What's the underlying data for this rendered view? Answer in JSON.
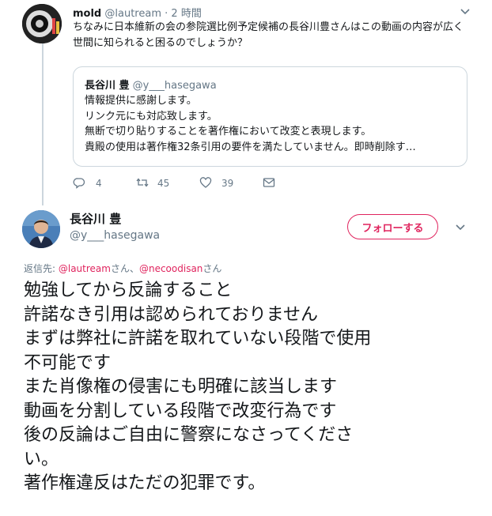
{
  "tweet1": {
    "name": "mold",
    "handle": "@lautream",
    "separator": "·",
    "time": "2 時間",
    "text": "ちなみに日本維新の会の参院選比例予定候補の長谷川豊さんはこの動画の内容が広く世間に知られると困るのでしょうか？",
    "caret_icon": "chevron-down-icon"
  },
  "quote": {
    "name": "長谷川 豊",
    "handle": "@y___hasegawa",
    "lines": [
      "情報提供に感謝します。",
      "リンク元にも対応致します。",
      "無断で切り貼りすることを著作権において改変と表現します。",
      "貴殿の使用は著作権32条引用の要件を満たしていません。即時削除す…"
    ]
  },
  "actions": {
    "reply_count": "4",
    "retweet_count": "45",
    "like_count": "39",
    "reply_icon": "reply-icon",
    "retweet_icon": "retweet-icon",
    "like_icon": "heart-icon",
    "dm_icon": "direct-message-icon"
  },
  "tweet2": {
    "name": "長谷川 豊",
    "handle": "@y___hasegawa",
    "follow_label": "フォローする",
    "reply_prefix": "返信先: ",
    "mention1": "@lautream",
    "sep": "さん、",
    "mention2": "@necoodisan",
    "suffix": "さん",
    "lines": [
      "勉強してから反論すること",
      "許諾なき引用は認められておりません",
      "まずは弊社に許諾を取れていない段階で使用",
      "不可能です",
      "また肖像権の侵害にも明確に該当します",
      "動画を分割している段階で改変行為です",
      "後の反論はご自由に警察になさってくださ",
      "い。",
      "著作権違反はただの犯罪です。"
    ]
  },
  "colors": {
    "accent": "#e0245e",
    "muted": "#657786",
    "border": "#ccd6dd",
    "text": "#14171a"
  }
}
